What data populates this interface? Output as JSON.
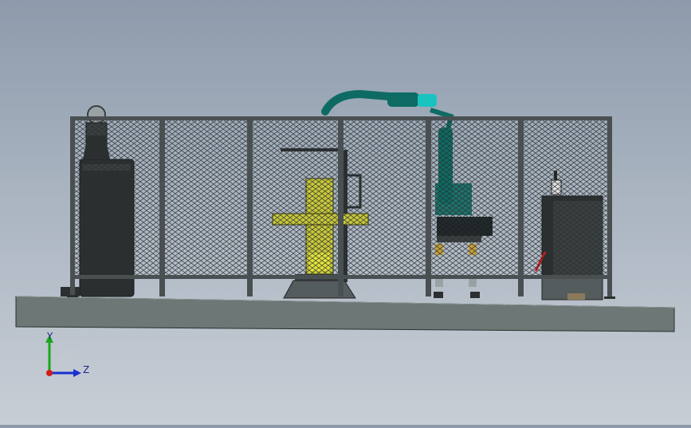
{
  "viewport": {
    "background_top": "#8c9aab",
    "background_bottom": "#c9ced6"
  },
  "colors": {
    "base_platform": "#6d7775",
    "fence_frame": "#4a5052",
    "mesh": "#2a2f30",
    "robot_teal": "#0e6b63",
    "robot_cyan": "#19c4c0",
    "positioner_yellow": "#c8c83a",
    "cabinet_dark": "#2b2f30",
    "axis_x": "#d11a1a",
    "axis_y": "#18a818",
    "axis_z": "#1a2fd1"
  },
  "coordinate_triad": {
    "y_label": "Y",
    "z_label": "Z",
    "icon": "axis-triad-icon"
  }
}
